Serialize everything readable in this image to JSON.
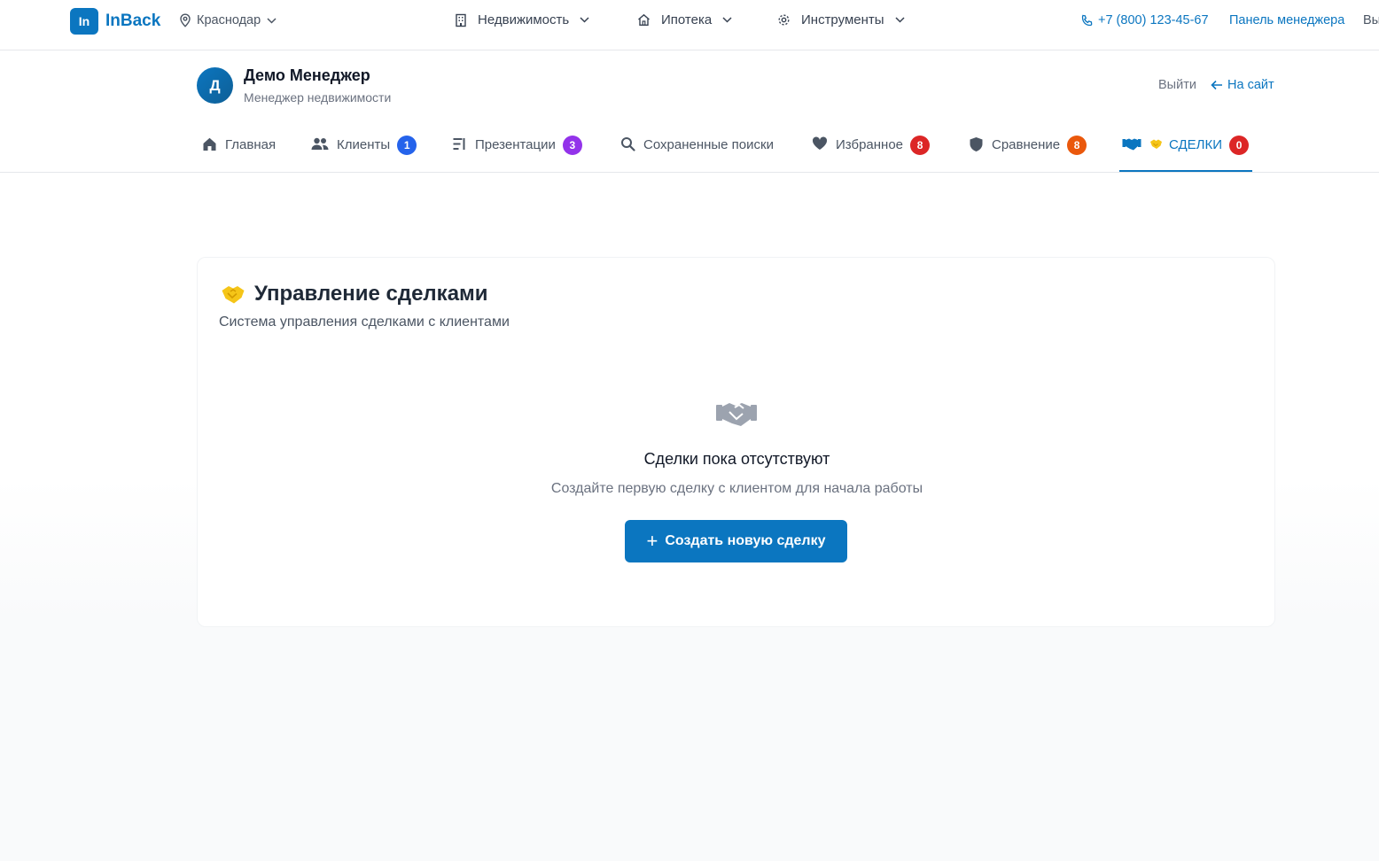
{
  "brand": {
    "logo_mark": "In",
    "name": "InBack",
    "color": "#0b76c0"
  },
  "location": {
    "city": "Краснодар"
  },
  "main_menu": [
    {
      "label": "Недвижимость",
      "icon": "building-icon"
    },
    {
      "label": "Ипотека",
      "icon": "home-icon"
    },
    {
      "label": "Инструменты",
      "icon": "gear-icon"
    }
  ],
  "contacts": {
    "phone": "+7 (800) 123-45-67",
    "panel_link": "Панель менеджера",
    "clipped_link": "Выйти"
  },
  "manager": {
    "initial": "Д",
    "name": "Демо Менеджер",
    "role": "Менеджер недвижимости",
    "logout": "Выйти",
    "to_site": "На сайт"
  },
  "tabs": [
    {
      "label": "Главная",
      "icon": "home-icon"
    },
    {
      "label": "Клиенты",
      "icon": "users-icon",
      "badge": "1",
      "badge_color": "#2563eb"
    },
    {
      "label": "Презентации",
      "icon": "presentation-icon",
      "badge": "3",
      "badge_color": "#9333ea"
    },
    {
      "label": "Сохраненные поиски",
      "icon": "search-icon"
    },
    {
      "label": "Избранное",
      "icon": "heart-icon",
      "badge": "8",
      "badge_color": "#dc2626"
    },
    {
      "label": "Сравнение",
      "icon": "shield-icon",
      "badge": "8",
      "badge_color": "#ea580c"
    },
    {
      "label": "СДЕЛКИ",
      "icon": "handshake-icon",
      "badge": "0",
      "badge_color": "#dc2626",
      "active": true
    }
  ],
  "deals": {
    "title": "Управление сделками",
    "subtitle": "Система управления сделками с клиентами",
    "empty_title": "Сделки пока отсутствуют",
    "empty_subtitle": "Создайте первую сделку с клиентом для начала работы",
    "create_button": "Создать новую сделку"
  }
}
